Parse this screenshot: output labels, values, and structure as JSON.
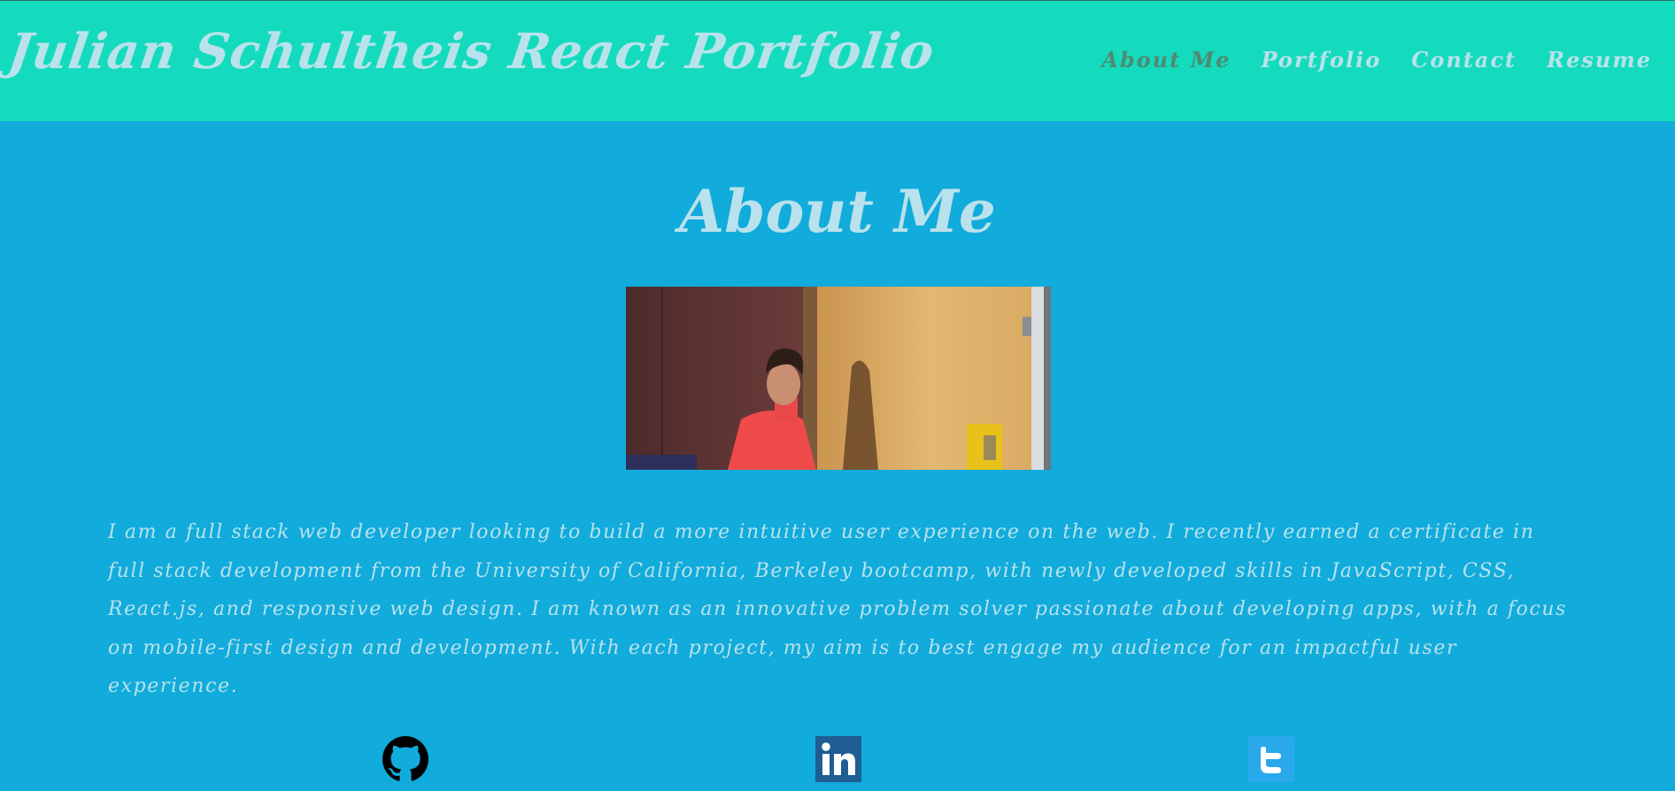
{
  "header": {
    "title": "Julian Schultheis React Portfolio",
    "nav": [
      {
        "label": "About Me",
        "active": true
      },
      {
        "label": "Portfolio",
        "active": false
      },
      {
        "label": "Contact",
        "active": false
      },
      {
        "label": "Resume",
        "active": false
      }
    ]
  },
  "main": {
    "heading": "About Me",
    "photo_alt": "portrait photo",
    "bio": "I am a full stack web developer looking to build a more intuitive user experience on the web. I recently earned a certificate in full stack development from the University of California, Berkeley bootcamp, with newly developed skills in JavaScript, CSS, React.js, and responsive web design. I am known as an innovative problem solver passionate about developing apps, with a focus on mobile-first design and development. With each project, my aim is to best engage my audience for an impactful user experience."
  },
  "social": [
    {
      "name": "github",
      "icon": "github-icon"
    },
    {
      "name": "linkedin",
      "icon": "linkedin-icon"
    },
    {
      "name": "twitter",
      "icon": "twitter-icon"
    }
  ],
  "colors": {
    "header_bg": "#14dbbd",
    "page_bg": "#11abdc",
    "text": "#b9e2ec",
    "nav_active": "#4f8a72"
  }
}
